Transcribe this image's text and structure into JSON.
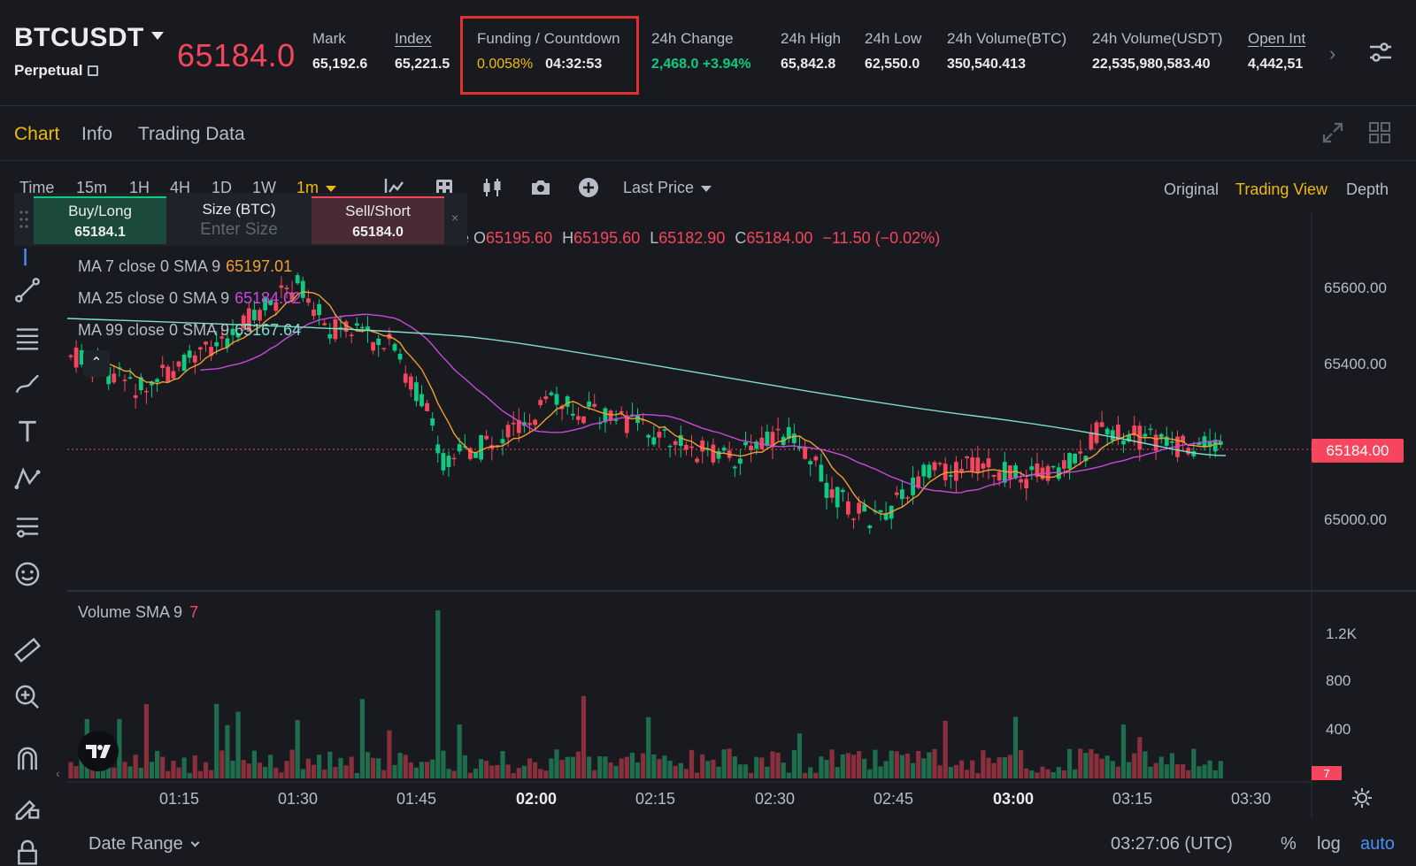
{
  "ticker": {
    "symbol": "BTCUSDT",
    "contract_type": "Perpetual",
    "last_price": "65184.0",
    "stats": {
      "mark": {
        "label": "Mark",
        "value": "65,192.6"
      },
      "index": {
        "label": "Index",
        "value": "65,221.5"
      },
      "funding": {
        "label": "Funding / Countdown",
        "rate": "0.0058%",
        "countdown": "04:32:53"
      },
      "change": {
        "label": "24h Change",
        "value": "2,468.0 +3.94%"
      },
      "high": {
        "label": "24h High",
        "value": "65,842.8"
      },
      "low": {
        "label": "24h Low",
        "value": "62,550.0"
      },
      "vol_btc": {
        "label": "24h Volume(BTC)",
        "value": "350,540.413"
      },
      "vol_usdt": {
        "label": "24h Volume(USDT)",
        "value": "22,535,980,583.40"
      },
      "open_interest": {
        "label": "Open Int",
        "value": "4,442,51"
      }
    }
  },
  "tabs": {
    "chart": "Chart",
    "info": "Info",
    "trading_data": "Trading Data",
    "active": "Chart"
  },
  "toolbar": {
    "timeframes": [
      "Time",
      "15m",
      "1H",
      "4H",
      "1D",
      "1W"
    ],
    "selected_interval": "1m",
    "price_type": "Last Price",
    "views": {
      "original": "Original",
      "trading_view": "Trading View",
      "depth": "Depth",
      "active": "Trading View"
    }
  },
  "quick_order": {
    "buy_label": "Buy/Long",
    "buy_price": "65184.1",
    "size_label": "Size (BTC)",
    "size_placeholder": "Enter Size",
    "sell_label": "Sell/Short",
    "sell_price": "65184.0",
    "close": "×"
  },
  "legend": {
    "ohlc_prefix": "e",
    "o": "65195.60",
    "h": "65195.60",
    "l": "65182.90",
    "c": "65184.00",
    "change": "−11.50 (−0.02%)",
    "ma7_label": "MA 7 close 0 SMA 9",
    "ma7_value": "65197.01",
    "ma25_label": "MA 25 close 0 SMA 9",
    "ma25_value": "65184.02",
    "ma99_label": "MA 99 close 0 SMA 9",
    "ma99_value": "65167.64",
    "volume_label": "Volume SMA 9",
    "volume_value": "7"
  },
  "price_axis": [
    "65600.00",
    "65400.00",
    "65000.00"
  ],
  "current_price_tag": "65184.00",
  "volume_axis": [
    "1.2K",
    "800",
    "400"
  ],
  "volume_tag": "7",
  "time_axis": [
    {
      "label": "01:15",
      "bold": false
    },
    {
      "label": "01:30",
      "bold": false
    },
    {
      "label": "01:45",
      "bold": false
    },
    {
      "label": "02:00",
      "bold": true
    },
    {
      "label": "02:15",
      "bold": false
    },
    {
      "label": "02:30",
      "bold": false
    },
    {
      "label": "02:45",
      "bold": false
    },
    {
      "label": "03:00",
      "bold": true
    },
    {
      "label": "03:15",
      "bold": false
    },
    {
      "label": "03:30",
      "bold": false
    }
  ],
  "bottom": {
    "date_range": "Date Range",
    "clock": "03:27:06 (UTC)",
    "percent": "%",
    "log": "log",
    "auto": "auto"
  },
  "colors": {
    "up": "#0ecb81",
    "down": "#f6465d",
    "accent": "#f0b90b",
    "ma7": "#f0a030",
    "ma25": "#c74ad8",
    "ma99": "#7fe0c9"
  },
  "icons": {
    "toolbar": [
      "indicator-icon",
      "template-icon",
      "candles-icon",
      "camera-icon",
      "plus-circle-icon"
    ],
    "left": [
      "crosshair-icon",
      "trendline-icon",
      "horizontal-lines-icon",
      "brush-icon",
      "text-icon",
      "pattern-icon",
      "fib-icon",
      "emoji-icon",
      "ruler-icon",
      "zoom-in-icon",
      "magnet-icon",
      "lock-pencil-icon",
      "lock-icon"
    ]
  }
}
